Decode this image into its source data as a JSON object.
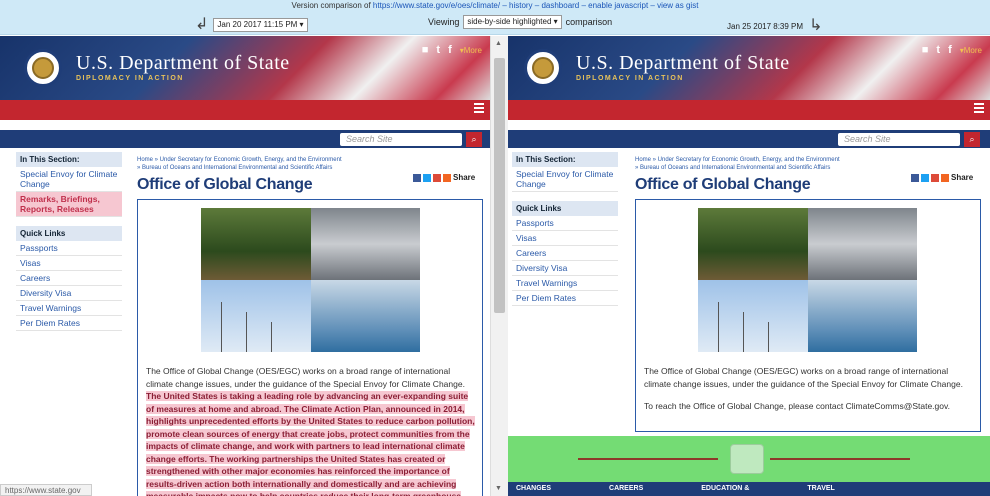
{
  "topbar": {
    "prefix": "Version comparison of ",
    "url": "https://www.state.gov/e/oes/climate/",
    "links": " – history – dashboard – enable javascript – view as gist",
    "left_date": "Jan 20 2017 11:15 PM ▾",
    "viewing_label": "Viewing",
    "view_mode": "side-by-side highlighted ▾",
    "comparison_label": "comparison",
    "right_date": "Jan 25 2017 8:39 PM"
  },
  "site": {
    "brand_main": "U.S. Department of State",
    "brand_sub": "DIPLOMACY IN ACTION",
    "more": "▾More",
    "search_placeholder": "Search Site",
    "search_btn": "🔍",
    "section_header": "In This Section:",
    "quick_links_header": "Quick Links",
    "quick_links": [
      "Passports",
      "Visas",
      "Careers",
      "Diversity Visa",
      "Travel Warnings",
      "Per Diem Rates"
    ],
    "crumb1": "Home » Under Secretary for Economic Growth, Energy, and the Environment",
    "crumb2": "» Bureau of Oceans and International Environmental and Scientific Affairs",
    "title": "Office of Global Change",
    "share": "Share"
  },
  "left": {
    "section_items": [
      "Special Envoy for Climate Change",
      "Remarks, Briefings, Reports, Releases"
    ],
    "para_plain": "The Office of Global Change (OES/EGC) works on a broad range of international climate change issues, under the guidance of the Special Envoy for Climate Change.",
    "para_highlight": "The United States is taking a leading role by advancing an ever-expanding suite of measures at home and abroad. The Climate Action Plan, announced in 2014, highlights unprecedented efforts by the United States to reduce carbon pollution, promote clean sources of energy that create jobs, protect communities from the impacts of climate change, and work with partners to lead international climate change efforts. The working partnerships the United States has created or strengthened with other major economies has reinforced the importance of results-driven action both internationally and domestically and are achieving measurable impacts now to help countries reduce their long-term greenhouse gas emissions.",
    "status_url": "https://www.state.gov"
  },
  "right": {
    "section_items": [
      "Special Envoy for Climate Change"
    ],
    "para1": "The Office of Global Change (OES/EGC) works on a broad range of international climate change issues, under the guidance of the Special Envoy for Climate Change.",
    "para2": "To reach the Office of Global Change, please contact ClimateComms@State.gov.",
    "footer_tabs": [
      "CHANGES",
      "CAREERS",
      "EDUCATION &",
      "TRAVEL"
    ]
  }
}
